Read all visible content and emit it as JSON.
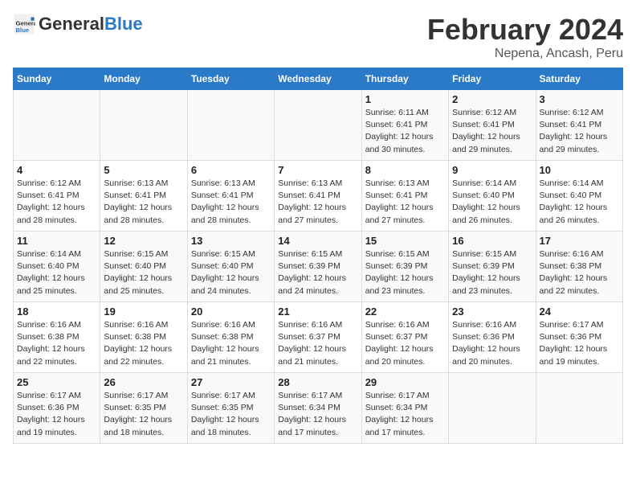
{
  "header": {
    "logo_general": "General",
    "logo_blue": "Blue",
    "main_title": "February 2024",
    "subtitle": "Nepena, Ancash, Peru"
  },
  "days_of_week": [
    "Sunday",
    "Monday",
    "Tuesday",
    "Wednesday",
    "Thursday",
    "Friday",
    "Saturday"
  ],
  "weeks": [
    {
      "days": [
        {
          "num": "",
          "info": ""
        },
        {
          "num": "",
          "info": ""
        },
        {
          "num": "",
          "info": ""
        },
        {
          "num": "",
          "info": ""
        },
        {
          "num": "1",
          "info": "Sunrise: 6:11 AM\nSunset: 6:41 PM\nDaylight: 12 hours\nand 30 minutes."
        },
        {
          "num": "2",
          "info": "Sunrise: 6:12 AM\nSunset: 6:41 PM\nDaylight: 12 hours\nand 29 minutes."
        },
        {
          "num": "3",
          "info": "Sunrise: 6:12 AM\nSunset: 6:41 PM\nDaylight: 12 hours\nand 29 minutes."
        }
      ]
    },
    {
      "days": [
        {
          "num": "4",
          "info": "Sunrise: 6:12 AM\nSunset: 6:41 PM\nDaylight: 12 hours\nand 28 minutes."
        },
        {
          "num": "5",
          "info": "Sunrise: 6:13 AM\nSunset: 6:41 PM\nDaylight: 12 hours\nand 28 minutes."
        },
        {
          "num": "6",
          "info": "Sunrise: 6:13 AM\nSunset: 6:41 PM\nDaylight: 12 hours\nand 28 minutes."
        },
        {
          "num": "7",
          "info": "Sunrise: 6:13 AM\nSunset: 6:41 PM\nDaylight: 12 hours\nand 27 minutes."
        },
        {
          "num": "8",
          "info": "Sunrise: 6:13 AM\nSunset: 6:41 PM\nDaylight: 12 hours\nand 27 minutes."
        },
        {
          "num": "9",
          "info": "Sunrise: 6:14 AM\nSunset: 6:40 PM\nDaylight: 12 hours\nand 26 minutes."
        },
        {
          "num": "10",
          "info": "Sunrise: 6:14 AM\nSunset: 6:40 PM\nDaylight: 12 hours\nand 26 minutes."
        }
      ]
    },
    {
      "days": [
        {
          "num": "11",
          "info": "Sunrise: 6:14 AM\nSunset: 6:40 PM\nDaylight: 12 hours\nand 25 minutes."
        },
        {
          "num": "12",
          "info": "Sunrise: 6:15 AM\nSunset: 6:40 PM\nDaylight: 12 hours\nand 25 minutes."
        },
        {
          "num": "13",
          "info": "Sunrise: 6:15 AM\nSunset: 6:40 PM\nDaylight: 12 hours\nand 24 minutes."
        },
        {
          "num": "14",
          "info": "Sunrise: 6:15 AM\nSunset: 6:39 PM\nDaylight: 12 hours\nand 24 minutes."
        },
        {
          "num": "15",
          "info": "Sunrise: 6:15 AM\nSunset: 6:39 PM\nDaylight: 12 hours\nand 23 minutes."
        },
        {
          "num": "16",
          "info": "Sunrise: 6:15 AM\nSunset: 6:39 PM\nDaylight: 12 hours\nand 23 minutes."
        },
        {
          "num": "17",
          "info": "Sunrise: 6:16 AM\nSunset: 6:38 PM\nDaylight: 12 hours\nand 22 minutes."
        }
      ]
    },
    {
      "days": [
        {
          "num": "18",
          "info": "Sunrise: 6:16 AM\nSunset: 6:38 PM\nDaylight: 12 hours\nand 22 minutes."
        },
        {
          "num": "19",
          "info": "Sunrise: 6:16 AM\nSunset: 6:38 PM\nDaylight: 12 hours\nand 22 minutes."
        },
        {
          "num": "20",
          "info": "Sunrise: 6:16 AM\nSunset: 6:38 PM\nDaylight: 12 hours\nand 21 minutes."
        },
        {
          "num": "21",
          "info": "Sunrise: 6:16 AM\nSunset: 6:37 PM\nDaylight: 12 hours\nand 21 minutes."
        },
        {
          "num": "22",
          "info": "Sunrise: 6:16 AM\nSunset: 6:37 PM\nDaylight: 12 hours\nand 20 minutes."
        },
        {
          "num": "23",
          "info": "Sunrise: 6:16 AM\nSunset: 6:36 PM\nDaylight: 12 hours\nand 20 minutes."
        },
        {
          "num": "24",
          "info": "Sunrise: 6:17 AM\nSunset: 6:36 PM\nDaylight: 12 hours\nand 19 minutes."
        }
      ]
    },
    {
      "days": [
        {
          "num": "25",
          "info": "Sunrise: 6:17 AM\nSunset: 6:36 PM\nDaylight: 12 hours\nand 19 minutes."
        },
        {
          "num": "26",
          "info": "Sunrise: 6:17 AM\nSunset: 6:35 PM\nDaylight: 12 hours\nand 18 minutes."
        },
        {
          "num": "27",
          "info": "Sunrise: 6:17 AM\nSunset: 6:35 PM\nDaylight: 12 hours\nand 18 minutes."
        },
        {
          "num": "28",
          "info": "Sunrise: 6:17 AM\nSunset: 6:34 PM\nDaylight: 12 hours\nand 17 minutes."
        },
        {
          "num": "29",
          "info": "Sunrise: 6:17 AM\nSunset: 6:34 PM\nDaylight: 12 hours\nand 17 minutes."
        },
        {
          "num": "",
          "info": ""
        },
        {
          "num": "",
          "info": ""
        }
      ]
    }
  ]
}
